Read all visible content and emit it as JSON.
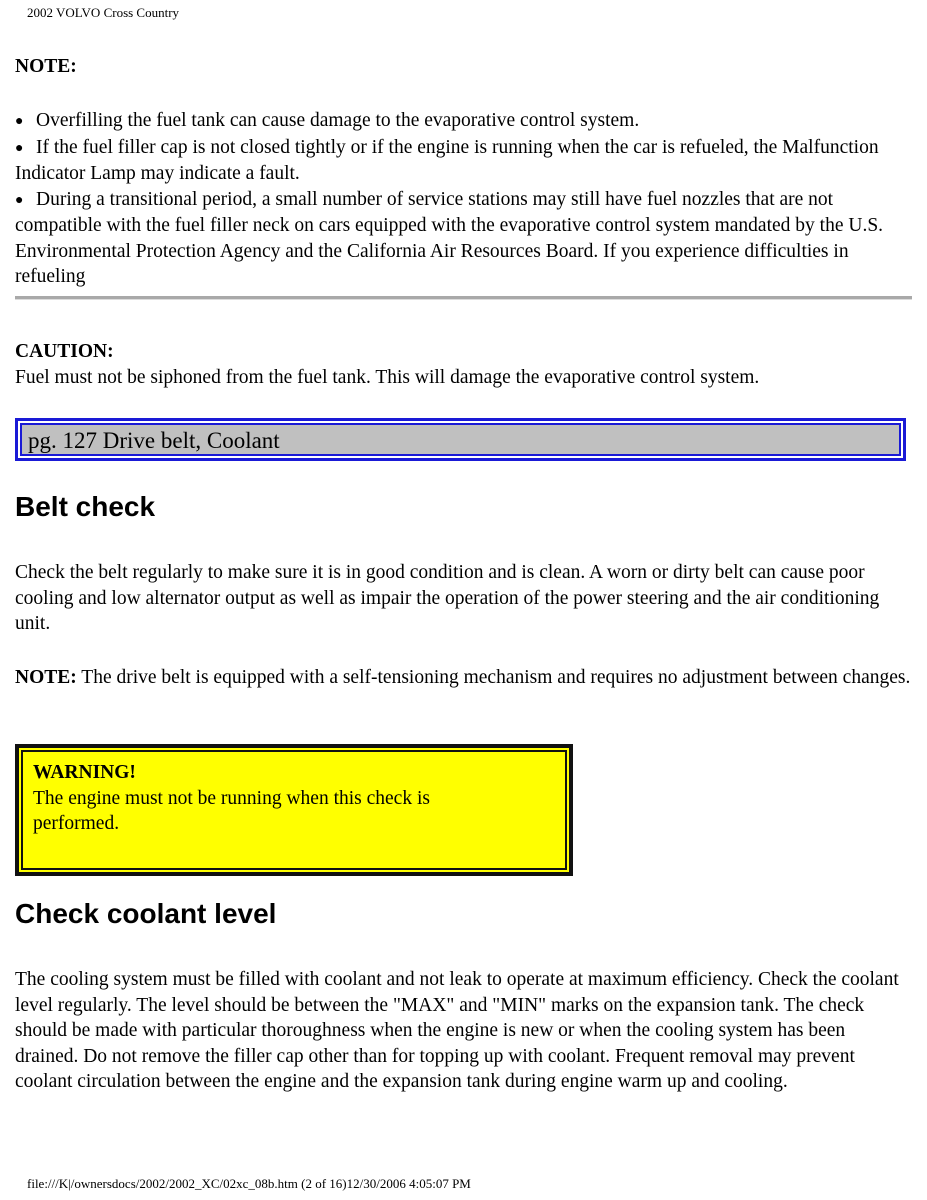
{
  "header": {
    "title": "2002 VOLVO Cross Country"
  },
  "note_section": {
    "title": "NOTE:",
    "bullets": [
      "Overfilling the fuel tank can cause damage to the evaporative control system.",
      "If the fuel filler cap is not closed tightly or if the engine is running when the car is refueled, the Malfunction Indicator Lamp may indicate a fault.",
      "During a transitional period, a small number of service stations may still have fuel nozzles that are not compatible with the fuel filler neck on cars equipped with the evaporative control system mandated by the U.S. Environmental Protection Agency and the California Air Resources Board. If you experience difficulties in refueling"
    ]
  },
  "caution": {
    "title": "CAUTION:",
    "text": "Fuel must not be siphoned from the fuel tank. This will damage the evaporative control system."
  },
  "page_banner": {
    "text": "pg. 127 Drive belt, Coolant",
    "border_color": "#1a1ad6",
    "fill_color": "#c0c0c0"
  },
  "belt_check": {
    "heading": "Belt check",
    "paragraph": "Check the belt regularly to make sure it is in good condition and is clean. A worn or dirty belt can cause poor cooling and low alternator output as well as impair the operation of the power steering and the air conditioning unit.",
    "note_label": "NOTE:",
    "note_text": " The drive belt is equipped with a self-tensioning mechanism and requires no adjustment between changes."
  },
  "warning": {
    "title": "WARNING!",
    "text": "The engine must not be running when this check is performed.",
    "fill_color": "#ffff00"
  },
  "coolant": {
    "heading": "Check coolant level",
    "paragraph": "The cooling system must be filled with coolant and not leak to operate at maximum efficiency. Check the coolant level regularly. The level should be between the \"MAX\" and \"MIN\" marks on the expansion tank. The check should be made with particular thoroughness when the engine is new or when the cooling system has been drained. Do not remove the filler cap other than for topping up with coolant. Frequent removal may prevent coolant circulation between the engine and the expansion tank during engine warm up and cooling."
  },
  "footer": {
    "text": "file:///K|/ownersdocs/2002/2002_XC/02xc_08b.htm (2 of 16)12/30/2006 4:05:07 PM"
  }
}
